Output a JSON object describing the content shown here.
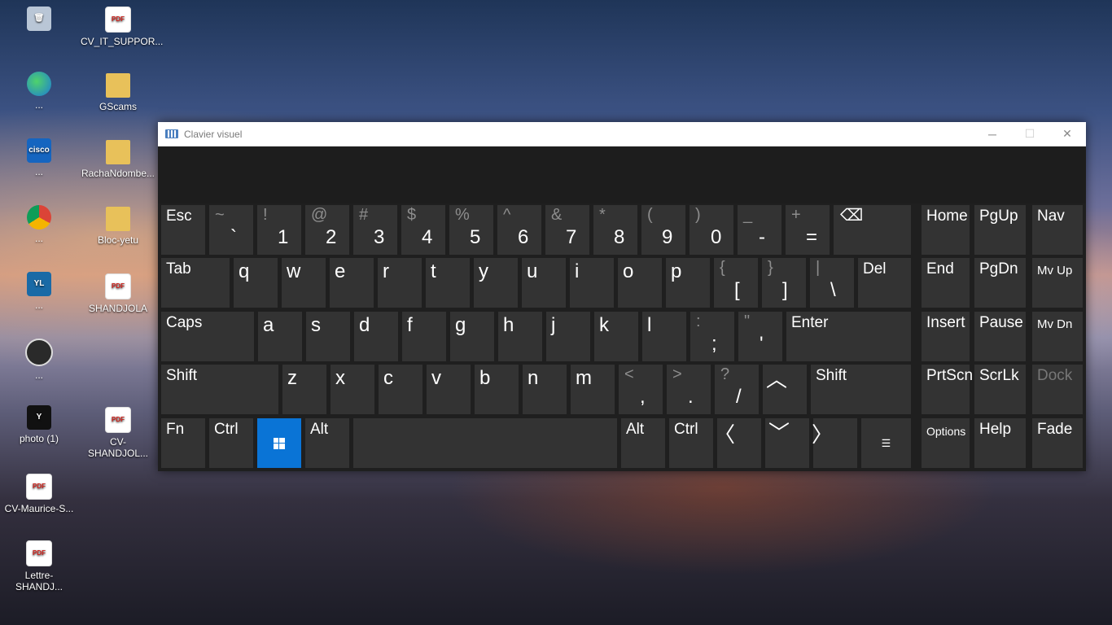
{
  "desktop": {
    "icons": [
      {
        "label": "",
        "icon": "recycle-bin-icon"
      },
      {
        "label": "CV_IT_SUPPOR...",
        "icon": "pdf-icon"
      },
      {
        "label": "...",
        "icon": "edge-icon"
      },
      {
        "label": "GScams",
        "icon": "folder-icon"
      },
      {
        "label": "...",
        "icon": "cisco-icon"
      },
      {
        "label": "RachaNdombe...",
        "icon": "folder-icon"
      },
      {
        "label": "...",
        "icon": "chrome-icon"
      },
      {
        "label": "Bloc-yetu",
        "icon": "folder-icon"
      },
      {
        "label": "...",
        "icon": "yl-app-icon"
      },
      {
        "label": "SHANDJOLA",
        "icon": "pdf-icon"
      },
      {
        "label": "...",
        "icon": "obs-icon"
      },
      {
        "label": "photo (1)",
        "icon": "photo-icon"
      },
      {
        "label": "CV-SHANDJOL...",
        "icon": "pdf-icon"
      },
      {
        "label": "CV-Maurice-S...",
        "icon": "pdf-icon"
      },
      {
        "label": "Lettre-SHANDJ...",
        "icon": "pdf-icon"
      }
    ],
    "pdf_badge": "PDF",
    "cisco_badge": "cisco",
    "yl_badge": "YL",
    "photo_badge": "Y"
  },
  "window": {
    "title": "Clavier visuel",
    "minimize": "─",
    "maximize": "☐",
    "close": "✕"
  },
  "keys": {
    "esc": "Esc",
    "tilde": {
      "shift": "~",
      "base": "`"
    },
    "n1": {
      "shift": "!",
      "base": "1"
    },
    "n2": {
      "shift": "@",
      "base": "2"
    },
    "n3": {
      "shift": "#",
      "base": "3"
    },
    "n4": {
      "shift": "$",
      "base": "4"
    },
    "n5": {
      "shift": "%",
      "base": "5"
    },
    "n6": {
      "shift": "^",
      "base": "6"
    },
    "n7": {
      "shift": "&",
      "base": "7"
    },
    "n8": {
      "shift": "*",
      "base": "8"
    },
    "n9": {
      "shift": "(",
      "base": "9"
    },
    "n0": {
      "shift": ")",
      "base": "0"
    },
    "minus": {
      "shift": "_",
      "base": "-"
    },
    "equals": {
      "shift": "+",
      "base": "="
    },
    "backspace": "⌫",
    "home": "Home",
    "pgup": "PgUp",
    "nav": "Nav",
    "tab": "Tab",
    "q": "q",
    "w": "w",
    "e": "e",
    "r": "r",
    "t": "t",
    "y": "y",
    "u": "u",
    "i": "i",
    "o": "o",
    "p": "p",
    "lbracket": {
      "shift": "{",
      "base": "["
    },
    "rbracket": {
      "shift": "}",
      "base": "]"
    },
    "backslash": {
      "shift": "|",
      "base": "\\"
    },
    "del": "Del",
    "end": "End",
    "pgdn": "PgDn",
    "mvup": "Mv Up",
    "caps": "Caps",
    "a": "a",
    "s": "s",
    "d": "d",
    "f": "f",
    "g": "g",
    "h": "h",
    "j": "j",
    "k": "k",
    "l": "l",
    "semicolon": {
      "shift": ":",
      "base": ";"
    },
    "quote": {
      "shift": "\"",
      "base": "'"
    },
    "enter": "Enter",
    "insert": "Insert",
    "pause": "Pause",
    "mvdn": "Mv Dn",
    "lshift": "Shift",
    "z": "z",
    "x": "x",
    "c": "c",
    "v": "v",
    "b": "b",
    "n": "n",
    "m": "m",
    "comma": {
      "shift": "<",
      "base": ","
    },
    "period": {
      "shift": ">",
      "base": "."
    },
    "slash": {
      "shift": "?",
      "base": "/"
    },
    "up": "︿",
    "rshift": "Shift",
    "prtscn": "PrtScn",
    "scrlk": "ScrLk",
    "dock": "Dock",
    "fn": "Fn",
    "lctrl": "Ctrl",
    "win": "windows",
    "lalt": "Alt",
    "space": "",
    "ralt": "Alt",
    "rctrl": "Ctrl",
    "left": "〈",
    "down": "﹀",
    "right": "〉",
    "menu": "☰",
    "options": "Options",
    "help": "Help",
    "fade": "Fade"
  }
}
